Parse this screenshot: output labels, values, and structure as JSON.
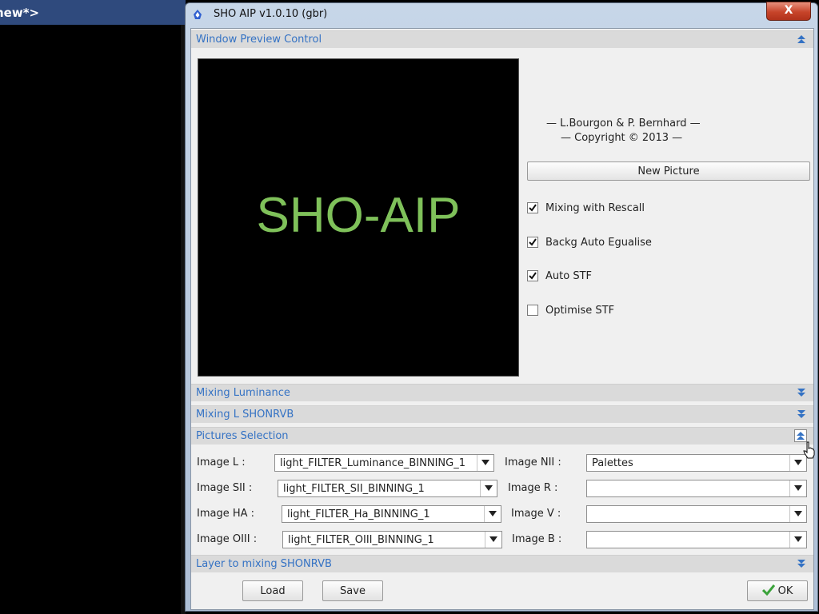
{
  "background": {
    "tab_label": "new*>"
  },
  "window": {
    "title": "SHO AIP v1.0.10 (gbr)",
    "close_label": "X",
    "accent": "#3472c4",
    "logo_color": "#7fc15a"
  },
  "sections": {
    "preview": "Window Preview Control",
    "mixing_luminance": "Mixing Luminance",
    "mixing_l": "Mixing L SHONRVB",
    "pictures": "Pictures Selection",
    "layer": "Layer to mixing SHONRVB"
  },
  "preview": {
    "logo_text": "SHO-AIP",
    "credits_line1": "— L.Bourgon & P. Bernhard —",
    "credits_line2": "— Copyright © 2013 —",
    "new_picture": "New Picture",
    "checkboxes": [
      {
        "label": "Mixing with Rescall",
        "checked": true
      },
      {
        "label": "Backg Auto Egualise",
        "checked": true
      },
      {
        "label": "Auto STF",
        "checked": true
      },
      {
        "label": "Optimise STF",
        "checked": false
      }
    ]
  },
  "pictures": {
    "left": [
      {
        "label": "Image L :",
        "value": "light_FILTER_Luminance_BINNING_1"
      },
      {
        "label": "Image SII :",
        "value": "light_FILTER_SII_BINNING_1"
      },
      {
        "label": "Image HA :",
        "value": "light_FILTER_Ha_BINNING_1"
      },
      {
        "label": "Image OIII :",
        "value": "light_FILTER_OIII_BINNING_1"
      }
    ],
    "right": [
      {
        "label": "Image NII :",
        "value": "Palettes"
      },
      {
        "label": "Image R :",
        "value": ""
      },
      {
        "label": "Image V :",
        "value": ""
      },
      {
        "label": "Image B :",
        "value": ""
      }
    ]
  },
  "footer": {
    "load": "Load",
    "save": "Save",
    "ok": "OK"
  }
}
